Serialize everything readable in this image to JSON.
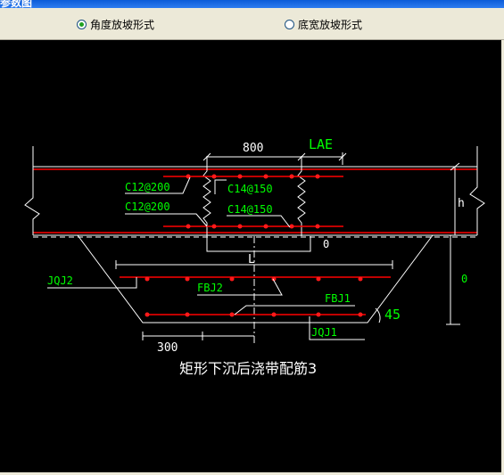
{
  "window": {
    "title": "参数图"
  },
  "options": {
    "radio1": {
      "label": "角度放坡形式",
      "selected": true
    },
    "radio2": {
      "label": "底宽放坡形式",
      "selected": false
    }
  },
  "drawing": {
    "dim_800": "800",
    "lae": "LAE",
    "c12_top": "C12@200",
    "c12_bot": "C12@200",
    "c14_top": "C14@150",
    "c14_bot": "C14@150",
    "h": "h",
    "zero_mid": "0",
    "L": "L",
    "zero_right": "0",
    "jqj2": "JQJ2",
    "fbj2": "FBJ2",
    "fbj1": "FBJ1",
    "angle": "45",
    "jqj1": "JQJ1",
    "dim_300": "300",
    "caption": "矩形下沉后浇带配筋3"
  },
  "colors": {
    "rebar": "#ff0000",
    "label_green": "#00ff00",
    "line_white": "#ffffff",
    "dot_red": "#ff1a1a"
  }
}
